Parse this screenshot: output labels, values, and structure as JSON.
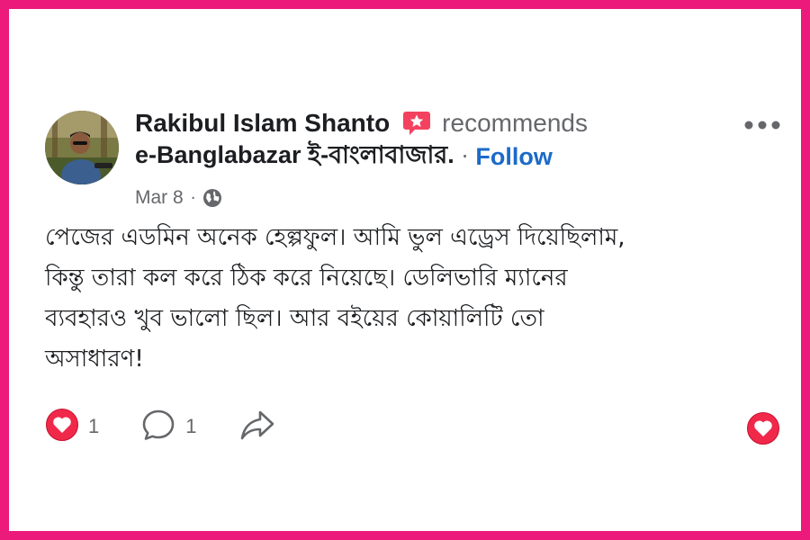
{
  "post": {
    "author_name": "Rakibul Islam Shanto",
    "action_text": "recommends",
    "page_name": "e-Banglabazar ই-বাংলাবাজার.",
    "separator": "·",
    "follow_label": "Follow",
    "date": "Mar 8",
    "meta_separator": "·",
    "privacy_icon": "globe-icon",
    "body_lines": [
      "পেজের এডমিন অনেক হেল্পফুল। আমি ভুল এড্রেস দিয়েছিলাম,",
      "কিন্তু তারা কল করে ঠিক করে নিয়েছে। ডেলিভারি ম্যানের",
      "ব্যবহারও খুব ভালো ছিল। আর বইয়ের কোয়ালিটি তো",
      "অসাধারণ!"
    ]
  },
  "actions": {
    "love_count": "1",
    "comment_count": "1",
    "icons": [
      "love-reaction-icon",
      "comment-icon",
      "share-icon",
      "love-button-icon"
    ]
  },
  "colors": {
    "frame_border": "#ec1a7b",
    "follow_link": "#1b6ac9",
    "secondary_text": "#65676b",
    "love_red": "#f0284a",
    "recommend_icon": "#f3425f"
  }
}
